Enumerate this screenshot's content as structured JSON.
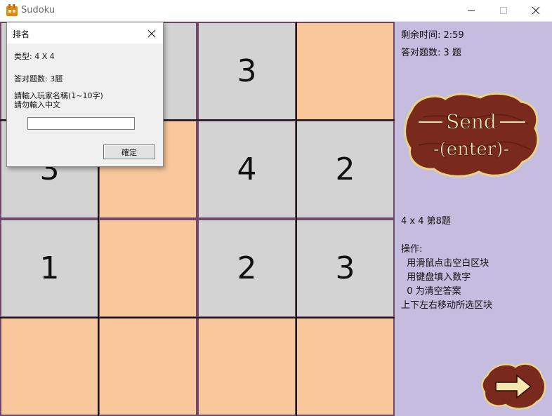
{
  "window": {
    "title": "Sudoku",
    "icon": "app-logo-icon"
  },
  "board": {
    "size": 4,
    "cells": [
      [
        {
          "value": "",
          "color": "gray"
        },
        {
          "value": "",
          "color": "gray"
        },
        {
          "value": "3",
          "color": "gray"
        },
        {
          "value": "",
          "color": "peach"
        }
      ],
      [
        {
          "value": "3",
          "color": "gray"
        },
        {
          "value": "",
          "color": "peach"
        },
        {
          "value": "4",
          "color": "gray"
        },
        {
          "value": "2",
          "color": "gray"
        }
      ],
      [
        {
          "value": "1",
          "color": "gray"
        },
        {
          "value": "",
          "color": "peach"
        },
        {
          "value": "2",
          "color": "gray"
        },
        {
          "value": "3",
          "color": "gray"
        }
      ],
      [
        {
          "value": "",
          "color": "peach"
        },
        {
          "value": "",
          "color": "peach"
        },
        {
          "value": "",
          "color": "peach"
        },
        {
          "value": "",
          "color": "peach"
        }
      ]
    ]
  },
  "panel": {
    "time_remaining": "剩余时间: 2:59",
    "correct_count": "答对题数: 3 题",
    "send_button": {
      "line1": "Send",
      "line2": "-(enter)-"
    },
    "puzzle_info": "4 x 4 第8题",
    "instructions": {
      "heading": "操作:",
      "lines": [
        "  用滑鼠点击空白区块",
        "  用键盘填入数字",
        "  0 为清空答案",
        "上下左右移动所选区块"
      ]
    },
    "next_button_icon": "arrow-right-icon"
  },
  "dialog": {
    "title": "排名",
    "type_label": "类型: 4 X 4",
    "correct_label": "答对题数: 3题",
    "prompt_line1": "請輸入玩家名稱(1~10字)",
    "prompt_line2": "請勿輸入中文",
    "name_value": "",
    "ok_label": "確定"
  },
  "colors": {
    "cell_gray": "#d3d3d3",
    "cell_peach": "#f8c89c",
    "grid_border": "#704868",
    "panel_bg": "#c6bcdf",
    "wood": "#7a2a1c",
    "wood_text": "#f5e6b0"
  }
}
